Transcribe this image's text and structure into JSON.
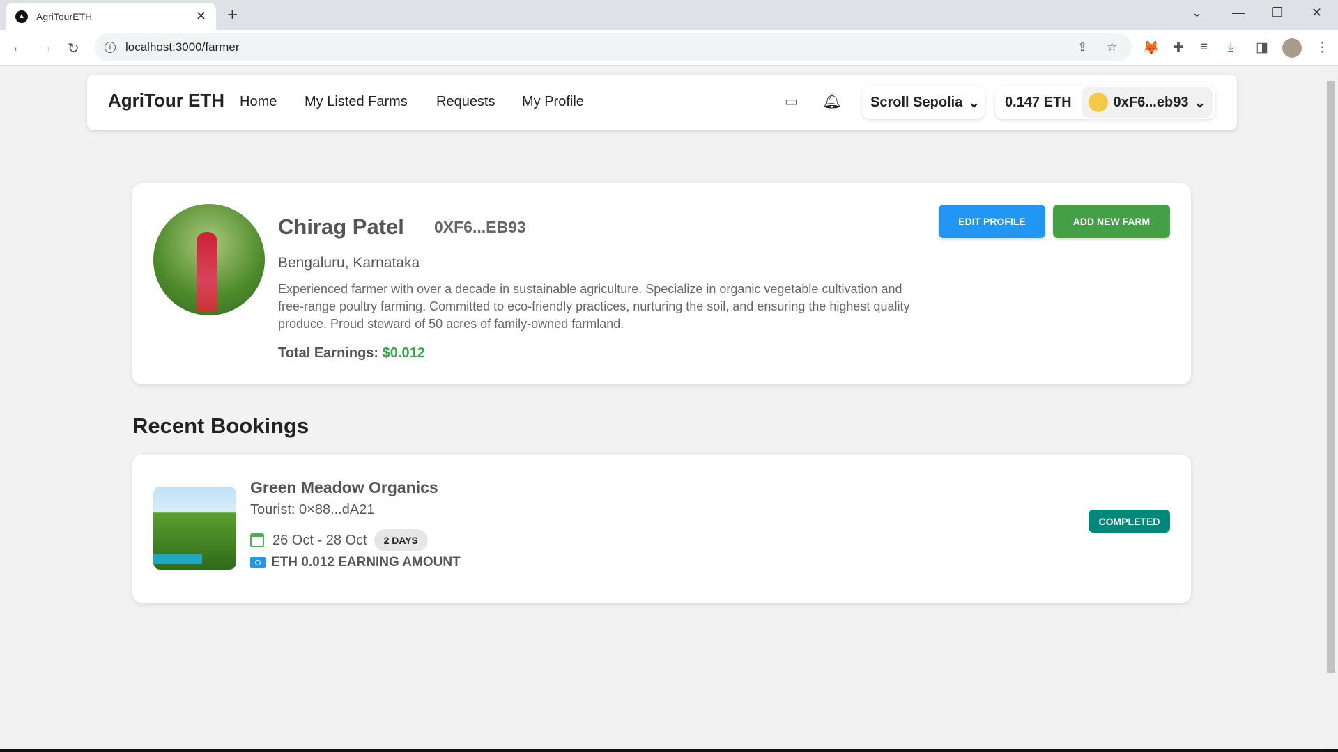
{
  "browser": {
    "tab_title": "AgriTourETH",
    "url": "localhost:3000/farmer"
  },
  "navbar": {
    "brand": "AgriTour ETH",
    "links": [
      "Home",
      "My Listed Farms",
      "Requests",
      "My Profile"
    ],
    "network": "Scroll Sepolia",
    "balance": "0.147 ETH",
    "account": "0xF6...eb93"
  },
  "profile": {
    "name": "Chirag Patel",
    "address": "0XF6...EB93",
    "location": "Bengaluru, Karnataka",
    "bio": "Experienced farmer with over a decade in sustainable agriculture. Specialize in organic vegetable cultivation and free-range poultry farming. Committed to eco-friendly practices, nurturing the soil, and ensuring the highest quality produce. Proud steward of 50 acres of family-owned farmland.",
    "earnings_label": "Total Earnings:",
    "earnings_value": "$0.012",
    "edit_label": "EDIT PROFILE",
    "add_farm_label": "ADD NEW FARM"
  },
  "bookings": {
    "heading": "Recent Bookings",
    "items": [
      {
        "farm": "Green Meadow Organics",
        "tourist": "Tourist: 0×88...dA21",
        "dates": "26 Oct - 28 Oct",
        "duration": "2 DAYS",
        "amount": "ETH 0.012 EARNING AMOUNT",
        "status": "COMPLETED",
        "status_color": "#00897b"
      }
    ]
  },
  "colors": {
    "edit": "#2196f3",
    "add": "#43a047",
    "earnings": "#3aa84a"
  }
}
